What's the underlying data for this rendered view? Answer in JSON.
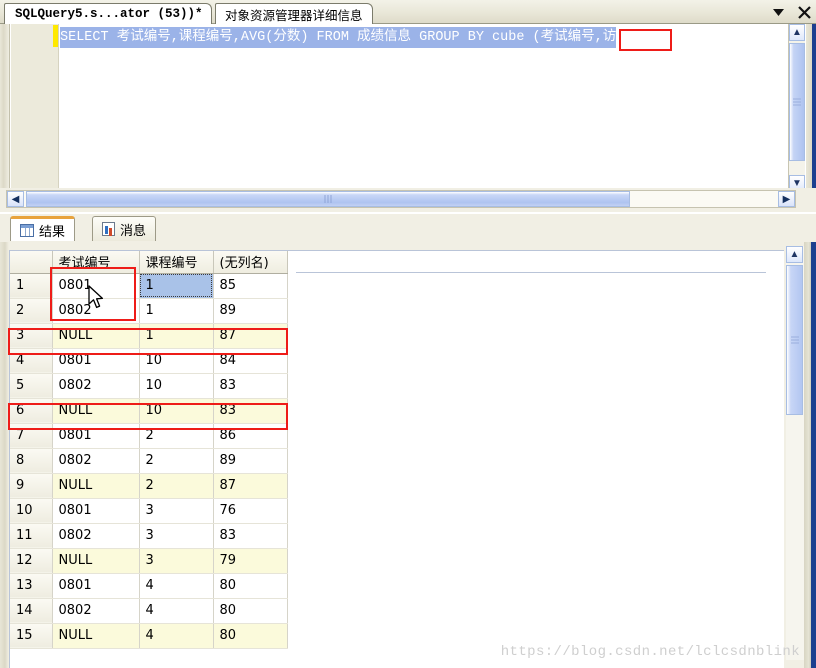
{
  "window": {
    "tabs": [
      {
        "label": "SQLQuery5.s...ator (53))*",
        "active": true
      },
      {
        "label": "对象资源管理器详细信息",
        "active": false
      }
    ],
    "dropdown_icon": "chevron-down-icon",
    "close_icon": "close-icon"
  },
  "editor": {
    "sql_segments": {
      "kw_select": "SELECT",
      "col1": " 考试编号,课程编号,",
      "fn_avg": "AVG",
      "paren1": "(",
      "arg1": "分数",
      "paren2": ")",
      "kw_from": " FROM ",
      "table": "成绩信息",
      "kw_group_by": " GROUP BY ",
      "kw_cube": "cube",
      "tail": " (考试编号,访"
    },
    "full_sql": "SELECT 考试编号,课程编号,AVG(分数) FROM 成绩信息 GROUP BY cube (考试编号,访",
    "highlight_term": "cube",
    "scroll_up_icon": "chevron-up-icon",
    "scroll_down_icon": "chevron-down-icon",
    "hscroll_left_icon": "chevron-left-icon",
    "hscroll_right_icon": "chevron-right-icon"
  },
  "results": {
    "tabs": [
      {
        "label": "结果",
        "icon": "results-grid-icon",
        "active": true
      },
      {
        "label": "消息",
        "icon": "messages-icon",
        "active": false
      }
    ],
    "grid": {
      "columns": [
        "",
        "考试编号",
        "课程编号",
        "(无列名)"
      ],
      "rows": [
        {
          "n": "1",
          "a": "0801",
          "b": "1",
          "c": "85",
          "null_row": false,
          "selected_col": "b"
        },
        {
          "n": "2",
          "a": "0802",
          "b": "1",
          "c": "89",
          "null_row": false,
          "selected_col": ""
        },
        {
          "n": "3",
          "a": "NULL",
          "b": "1",
          "c": "87",
          "null_row": true,
          "selected_col": ""
        },
        {
          "n": "4",
          "a": "0801",
          "b": "10",
          "c": "84",
          "null_row": false,
          "selected_col": ""
        },
        {
          "n": "5",
          "a": "0802",
          "b": "10",
          "c": "83",
          "null_row": false,
          "selected_col": ""
        },
        {
          "n": "6",
          "a": "NULL",
          "b": "10",
          "c": "83",
          "null_row": true,
          "selected_col": ""
        },
        {
          "n": "7",
          "a": "0801",
          "b": "2",
          "c": "86",
          "null_row": false,
          "selected_col": ""
        },
        {
          "n": "8",
          "a": "0802",
          "b": "2",
          "c": "89",
          "null_row": false,
          "selected_col": ""
        },
        {
          "n": "9",
          "a": "NULL",
          "b": "2",
          "c": "87",
          "null_row": true,
          "selected_col": ""
        },
        {
          "n": "10",
          "a": "0801",
          "b": "3",
          "c": "76",
          "null_row": false,
          "selected_col": ""
        },
        {
          "n": "11",
          "a": "0802",
          "b": "3",
          "c": "83",
          "null_row": false,
          "selected_col": ""
        },
        {
          "n": "12",
          "a": "NULL",
          "b": "3",
          "c": "79",
          "null_row": true,
          "selected_col": ""
        },
        {
          "n": "13",
          "a": "0801",
          "b": "4",
          "c": "80",
          "null_row": false,
          "selected_col": ""
        },
        {
          "n": "14",
          "a": "0802",
          "b": "4",
          "c": "80",
          "null_row": false,
          "selected_col": ""
        },
        {
          "n": "15",
          "a": "NULL",
          "b": "4",
          "c": "80",
          "null_row": true,
          "selected_col": ""
        }
      ]
    },
    "scroll_up_icon": "chevron-up-icon"
  },
  "annotations": {
    "accent_red": "#ee1c18",
    "boxes": [
      {
        "name": "cube-keyword-highlight"
      },
      {
        "name": "rows-1-2-exam-id-highlight"
      },
      {
        "name": "row-3-null-highlight"
      },
      {
        "name": "row-6-null-highlight"
      }
    ]
  },
  "watermark": {
    "text": "https://blog.csdn.net/lclcsdnblink"
  }
}
